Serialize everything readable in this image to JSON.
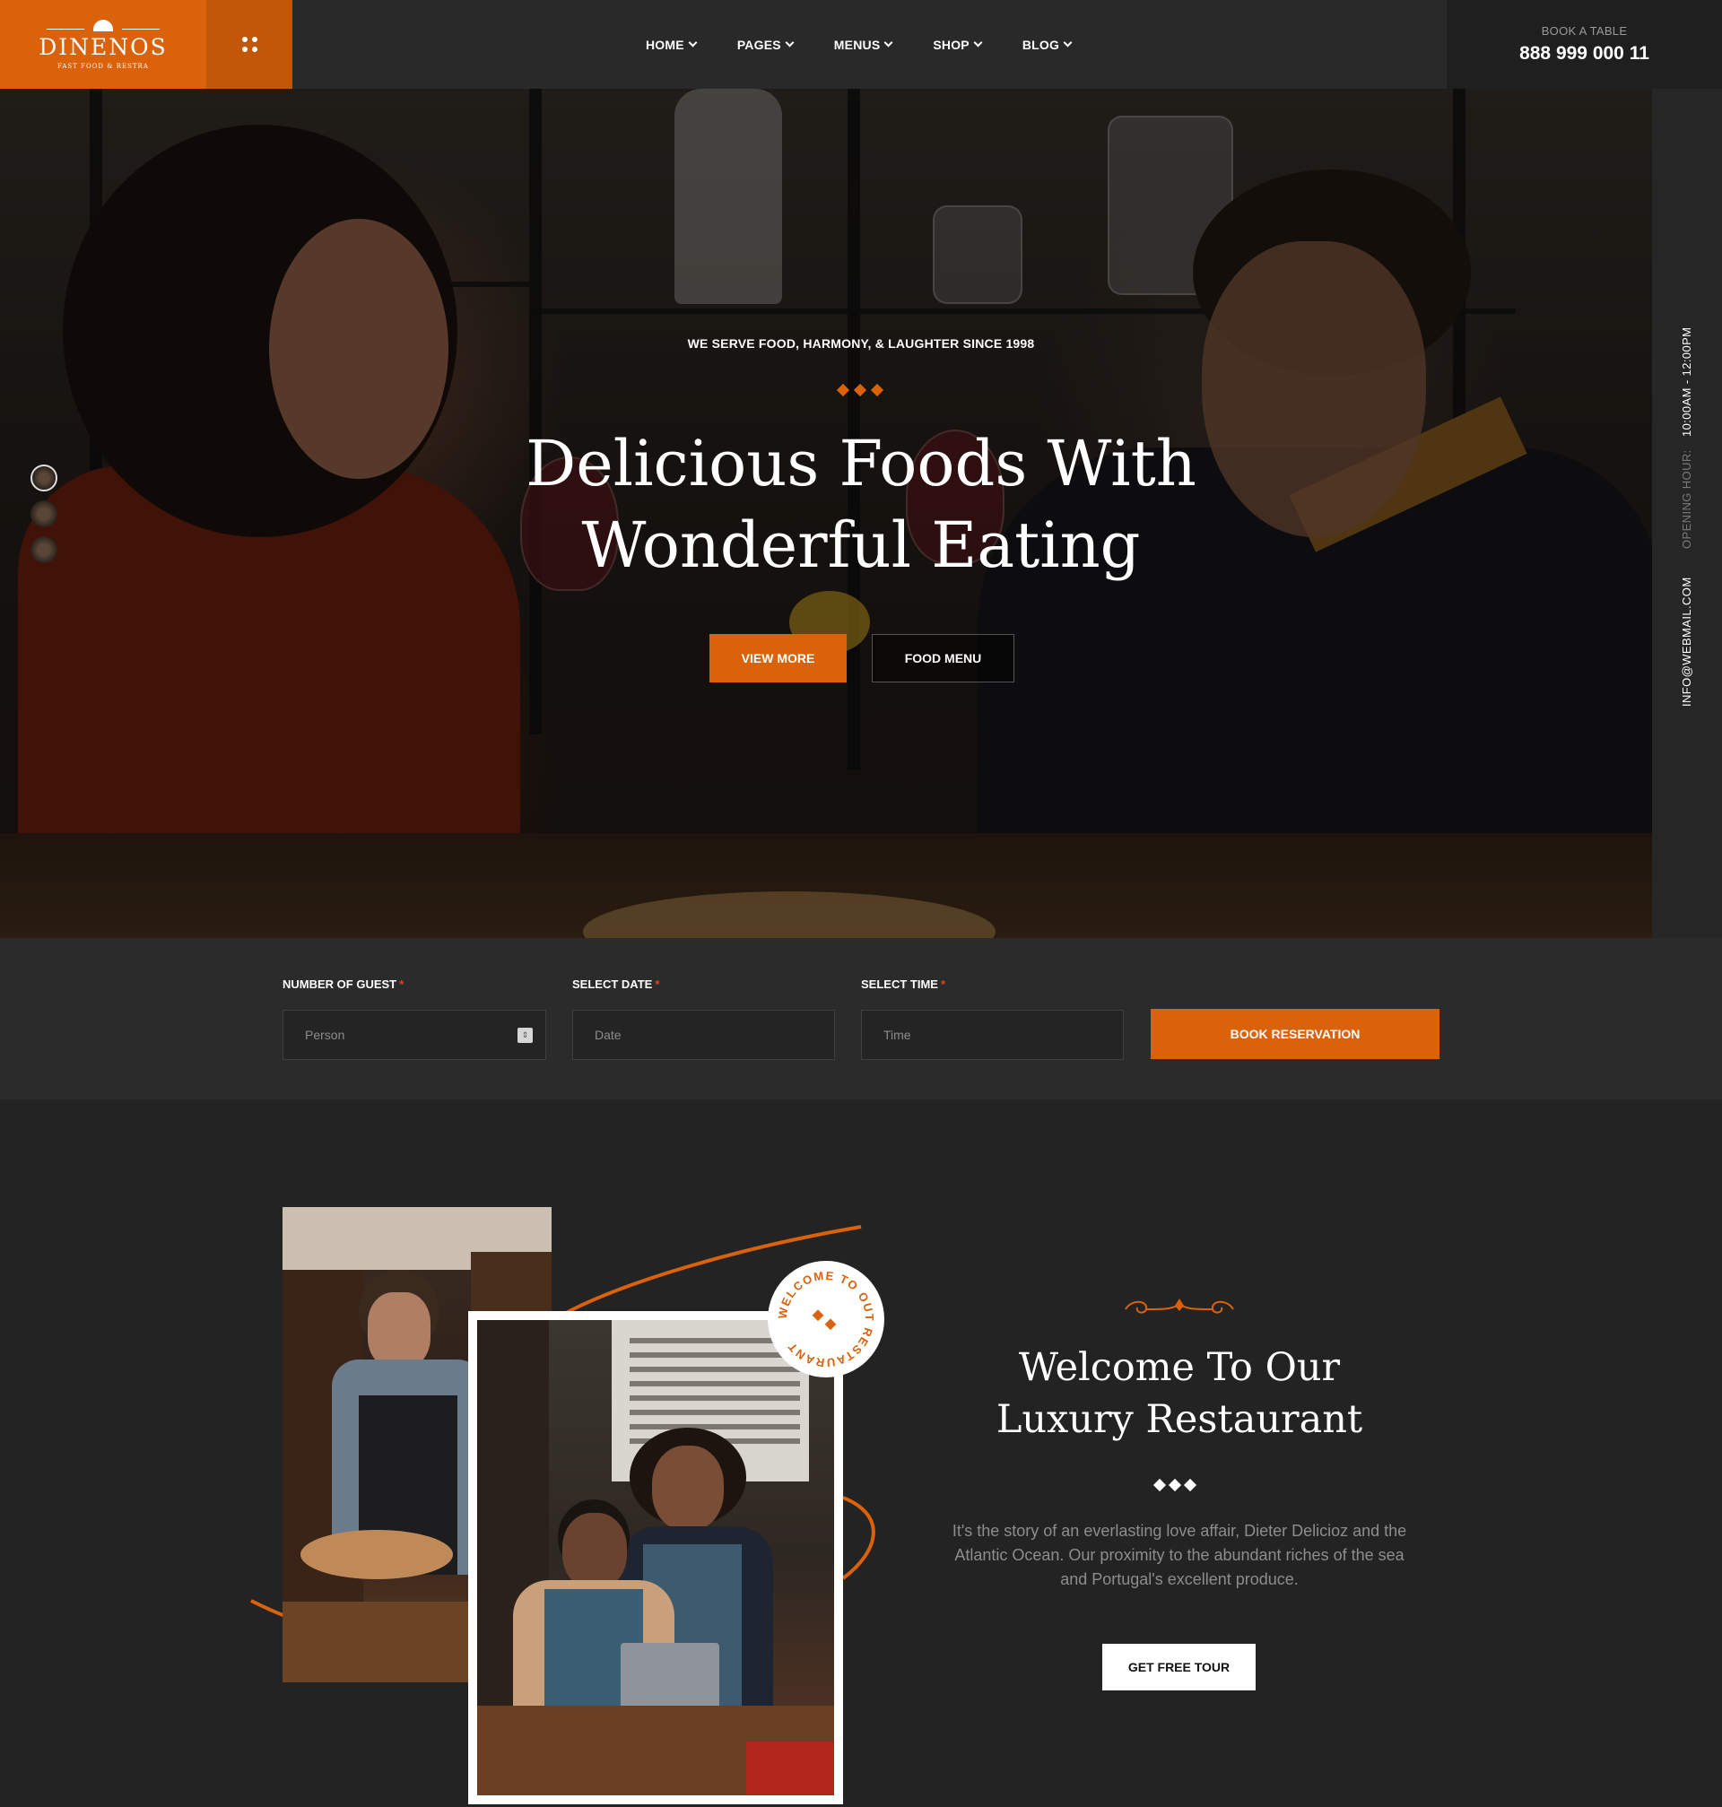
{
  "brand": {
    "name": "DINENOS",
    "tagline": "FAST FOOD & RESTRA",
    "accent_color": "#d9620b"
  },
  "header": {
    "menu_toggle_icon": "grid-dots-icon",
    "nav": [
      {
        "label": "HOME"
      },
      {
        "label": "PAGES"
      },
      {
        "label": "MENUS"
      },
      {
        "label": "SHOP"
      },
      {
        "label": "BLOG"
      }
    ],
    "book_label": "BOOK A TABLE",
    "book_phone": "888 999 000 11"
  },
  "hero": {
    "eyebrow": "WE SERVE FOOD, HARMONY, & LAUGHTER SINCE 1998",
    "title_line1": "Delicious Foods With",
    "title_line2": "Wonderful Eating",
    "primary_button": "VIEW MORE",
    "secondary_button": "FOOD MENU",
    "slide_count": 3,
    "active_slide": 1,
    "side_opening_label": "OPENING HOUR:",
    "side_opening_hours": "10:00AM - 12:00PM",
    "side_email": "INFO@WEBMAIL.COM"
  },
  "reservation": {
    "guest_label": "NUMBER OF GUEST",
    "guest_placeholder": "Person",
    "date_label": "SELECT DATE",
    "date_placeholder": "Date",
    "time_label": "SELECT TIME",
    "time_placeholder": "Time",
    "required_mark": "*",
    "submit_label": "BOOK RESERVATION"
  },
  "welcome": {
    "badge_text": "WELCOME TO OUT RESTAURANT",
    "title_line1": "Welcome To Our",
    "title_line2": "Luxury Restaurant",
    "paragraph": "It's the story of an everlasting love affair, Dieter Delicioz and the Atlantic Ocean. Our proximity to the abundant riches of the sea and Portugal's excellent produce.",
    "button": "GET FREE TOUR"
  }
}
